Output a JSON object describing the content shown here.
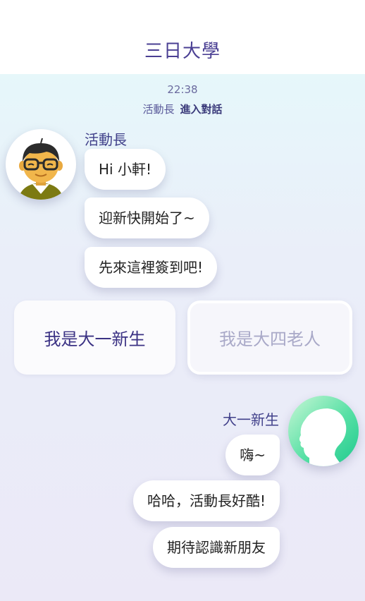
{
  "header": {
    "title": "三日大學"
  },
  "chat": {
    "timestamp": "22:38",
    "system": {
      "who": "活動長",
      "action": "進入對話"
    },
    "left_sender": "活動長",
    "left_messages": [
      "Hi 小軒!",
      "迎新快開始了~",
      "先來這裡簽到吧!"
    ],
    "choices": [
      "我是大一新生",
      "我是大四老人"
    ],
    "right_sender": "大一新生",
    "right_messages": [
      "嗨~",
      "哈哈，活動長好酷!",
      "期待認識新朋友"
    ]
  },
  "colors": {
    "title": "#4a3f93",
    "bubble": "#ffffff",
    "avatar_right_accent": "#1fc98e"
  },
  "icons": {
    "left_avatar": "cartoon-man-with-glasses",
    "right_avatar": "head-silhouette"
  }
}
